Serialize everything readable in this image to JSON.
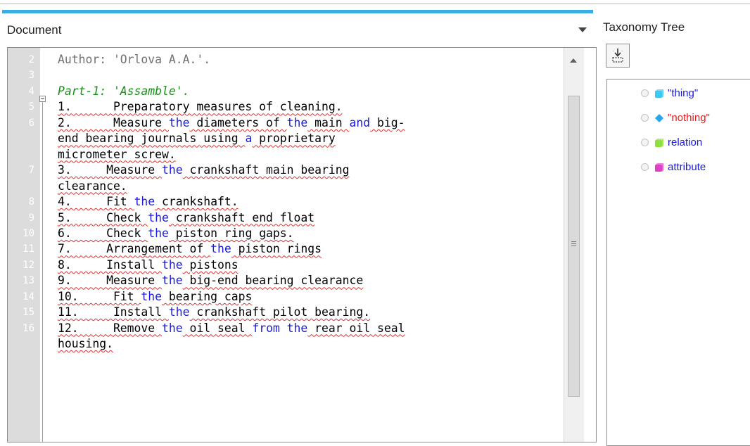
{
  "document": {
    "title": "Document",
    "lines": [
      {
        "num": "2",
        "style": "gray",
        "segments": [
          {
            "t": "Author: 'Orlova A.A.'."
          }
        ]
      },
      {
        "num": "3",
        "style": "plain",
        "segments": []
      },
      {
        "num": "4",
        "style": "green",
        "segments": [
          {
            "t": "Part-1: 'Assamble'."
          }
        ]
      },
      {
        "num": "5",
        "style": "plain",
        "segments": [
          {
            "t": "1.      Preparatory measures of cleaning.",
            "sq": true
          }
        ]
      },
      {
        "num": "6",
        "style": "plain",
        "segments": [
          {
            "t": "2.      Measure ",
            "sq": true
          },
          {
            "t": "the",
            "c": "#1a1adc"
          },
          {
            "t": " diameters of ",
            "sq": true
          },
          {
            "t": "the",
            "c": "#1a1adc"
          },
          {
            "t": " main ",
            "sq": true
          },
          {
            "t": "and",
            "c": "#1a1adc"
          },
          {
            "t": " big-",
            "sq": true
          }
        ]
      },
      {
        "num": "",
        "style": "plain",
        "segments": [
          {
            "t": "end bearing journals using ",
            "sq": true
          },
          {
            "t": "a",
            "c": "#1a1adc"
          },
          {
            "t": " proprietary",
            "sq": true
          }
        ]
      },
      {
        "num": "",
        "style": "plain",
        "segments": [
          {
            "t": "micrometer screw.",
            "sq": true
          }
        ]
      },
      {
        "num": "7",
        "style": "plain",
        "segments": [
          {
            "t": "3.     Measure ",
            "sq": true
          },
          {
            "t": "the",
            "c": "#1a1adc"
          },
          {
            "t": " crankshaft main bearing",
            "sq": true
          }
        ]
      },
      {
        "num": "",
        "style": "plain",
        "segments": [
          {
            "t": "clearance.",
            "sq": true
          }
        ]
      },
      {
        "num": "8",
        "style": "plain",
        "segments": [
          {
            "t": "4.     Fit ",
            "sq": true
          },
          {
            "t": "the",
            "c": "#1a1adc"
          },
          {
            "t": " crankshaft.",
            "sq": true
          }
        ]
      },
      {
        "num": "9",
        "style": "plain",
        "segments": [
          {
            "t": "5.     Check ",
            "sq": true
          },
          {
            "t": "the",
            "c": "#1a1adc"
          },
          {
            "t": " crankshaft end float",
            "sq": true
          }
        ]
      },
      {
        "num": "10",
        "style": "plain",
        "segments": [
          {
            "t": "6.     Check ",
            "sq": true
          },
          {
            "t": "the",
            "c": "#1a1adc"
          },
          {
            "t": " piston ring gaps.",
            "sq": true
          }
        ]
      },
      {
        "num": "11",
        "style": "plain",
        "segments": [
          {
            "t": "7.     Arrangement of ",
            "sq": true
          },
          {
            "t": "the",
            "c": "#1a1adc"
          },
          {
            "t": " piston rings",
            "sq": true
          }
        ]
      },
      {
        "num": "12",
        "style": "plain",
        "segments": [
          {
            "t": "8.     Install ",
            "sq": true
          },
          {
            "t": "the",
            "c": "#1a1adc"
          },
          {
            "t": " pistons",
            "sq": true
          }
        ]
      },
      {
        "num": "13",
        "style": "plain",
        "segments": [
          {
            "t": "9.     Measure ",
            "sq": true
          },
          {
            "t": "the",
            "c": "#1a1adc"
          },
          {
            "t": " big-end bearing clearance",
            "sq": true
          }
        ]
      },
      {
        "num": "14",
        "style": "plain",
        "segments": [
          {
            "t": "10.     Fit ",
            "sq": true
          },
          {
            "t": "the",
            "c": "#1a1adc"
          },
          {
            "t": " bearing caps",
            "sq": true
          }
        ]
      },
      {
        "num": "15",
        "style": "plain",
        "segments": [
          {
            "t": "11.     Install ",
            "sq": true
          },
          {
            "t": "the",
            "c": "#1a1adc"
          },
          {
            "t": " crankshaft pilot bearing.",
            "sq": true
          }
        ]
      },
      {
        "num": "16",
        "style": "plain",
        "segments": [
          {
            "t": "12.     Remove ",
            "sq": true
          },
          {
            "t": "the",
            "c": "#1a1adc"
          },
          {
            "t": " oil seal ",
            "sq": true
          },
          {
            "t": "from the",
            "c": "#1a1adc"
          },
          {
            "t": " rear oil seal",
            "sq": true
          }
        ]
      },
      {
        "num": "",
        "style": "plain",
        "segments": [
          {
            "t": "housing.",
            "sq": true
          }
        ]
      }
    ]
  },
  "taxonomy": {
    "title": "Taxonomy Tree",
    "import_icon": "import-icon",
    "nodes": [
      {
        "label": "\"thing\"",
        "color": "#1a1adc",
        "icon": "cube",
        "icon_color": "#3cc8f0"
      },
      {
        "label": "\"nothing\"",
        "color": "#e02020",
        "icon": "diamond",
        "icon_color": "#2aa6e8"
      },
      {
        "label": "relation",
        "color": "#1a1adc",
        "icon": "cube",
        "icon_color": "#8ee040"
      },
      {
        "label": "attribute",
        "color": "#1a1adc",
        "icon": "cube",
        "icon_color": "#e040c8"
      }
    ]
  }
}
